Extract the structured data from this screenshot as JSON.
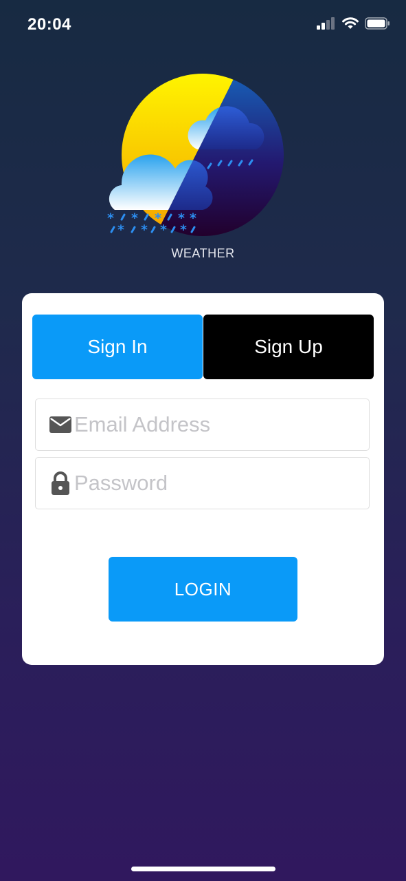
{
  "status_bar": {
    "time": "20:04",
    "icons": [
      "cellular-signal-icon",
      "wifi-icon",
      "battery-icon"
    ]
  },
  "app": {
    "name": "WEATHER",
    "logo_icon": "weather-day-night-icon"
  },
  "auth_tabs": {
    "sign_in_label": "Sign In",
    "sign_up_label": "Sign Up",
    "active": "Sign In"
  },
  "form": {
    "email": {
      "placeholder": "Email Address",
      "value": "",
      "icon": "mail-icon"
    },
    "password": {
      "placeholder": "Password",
      "value": "",
      "icon": "lock-icon"
    },
    "login_label": "LOGIN"
  },
  "colors": {
    "accent": "#0a9af8",
    "inactive_tab": "#000000",
    "card": "#ffffff",
    "background_top": "#172a42",
    "background_bottom": "#30185e"
  }
}
